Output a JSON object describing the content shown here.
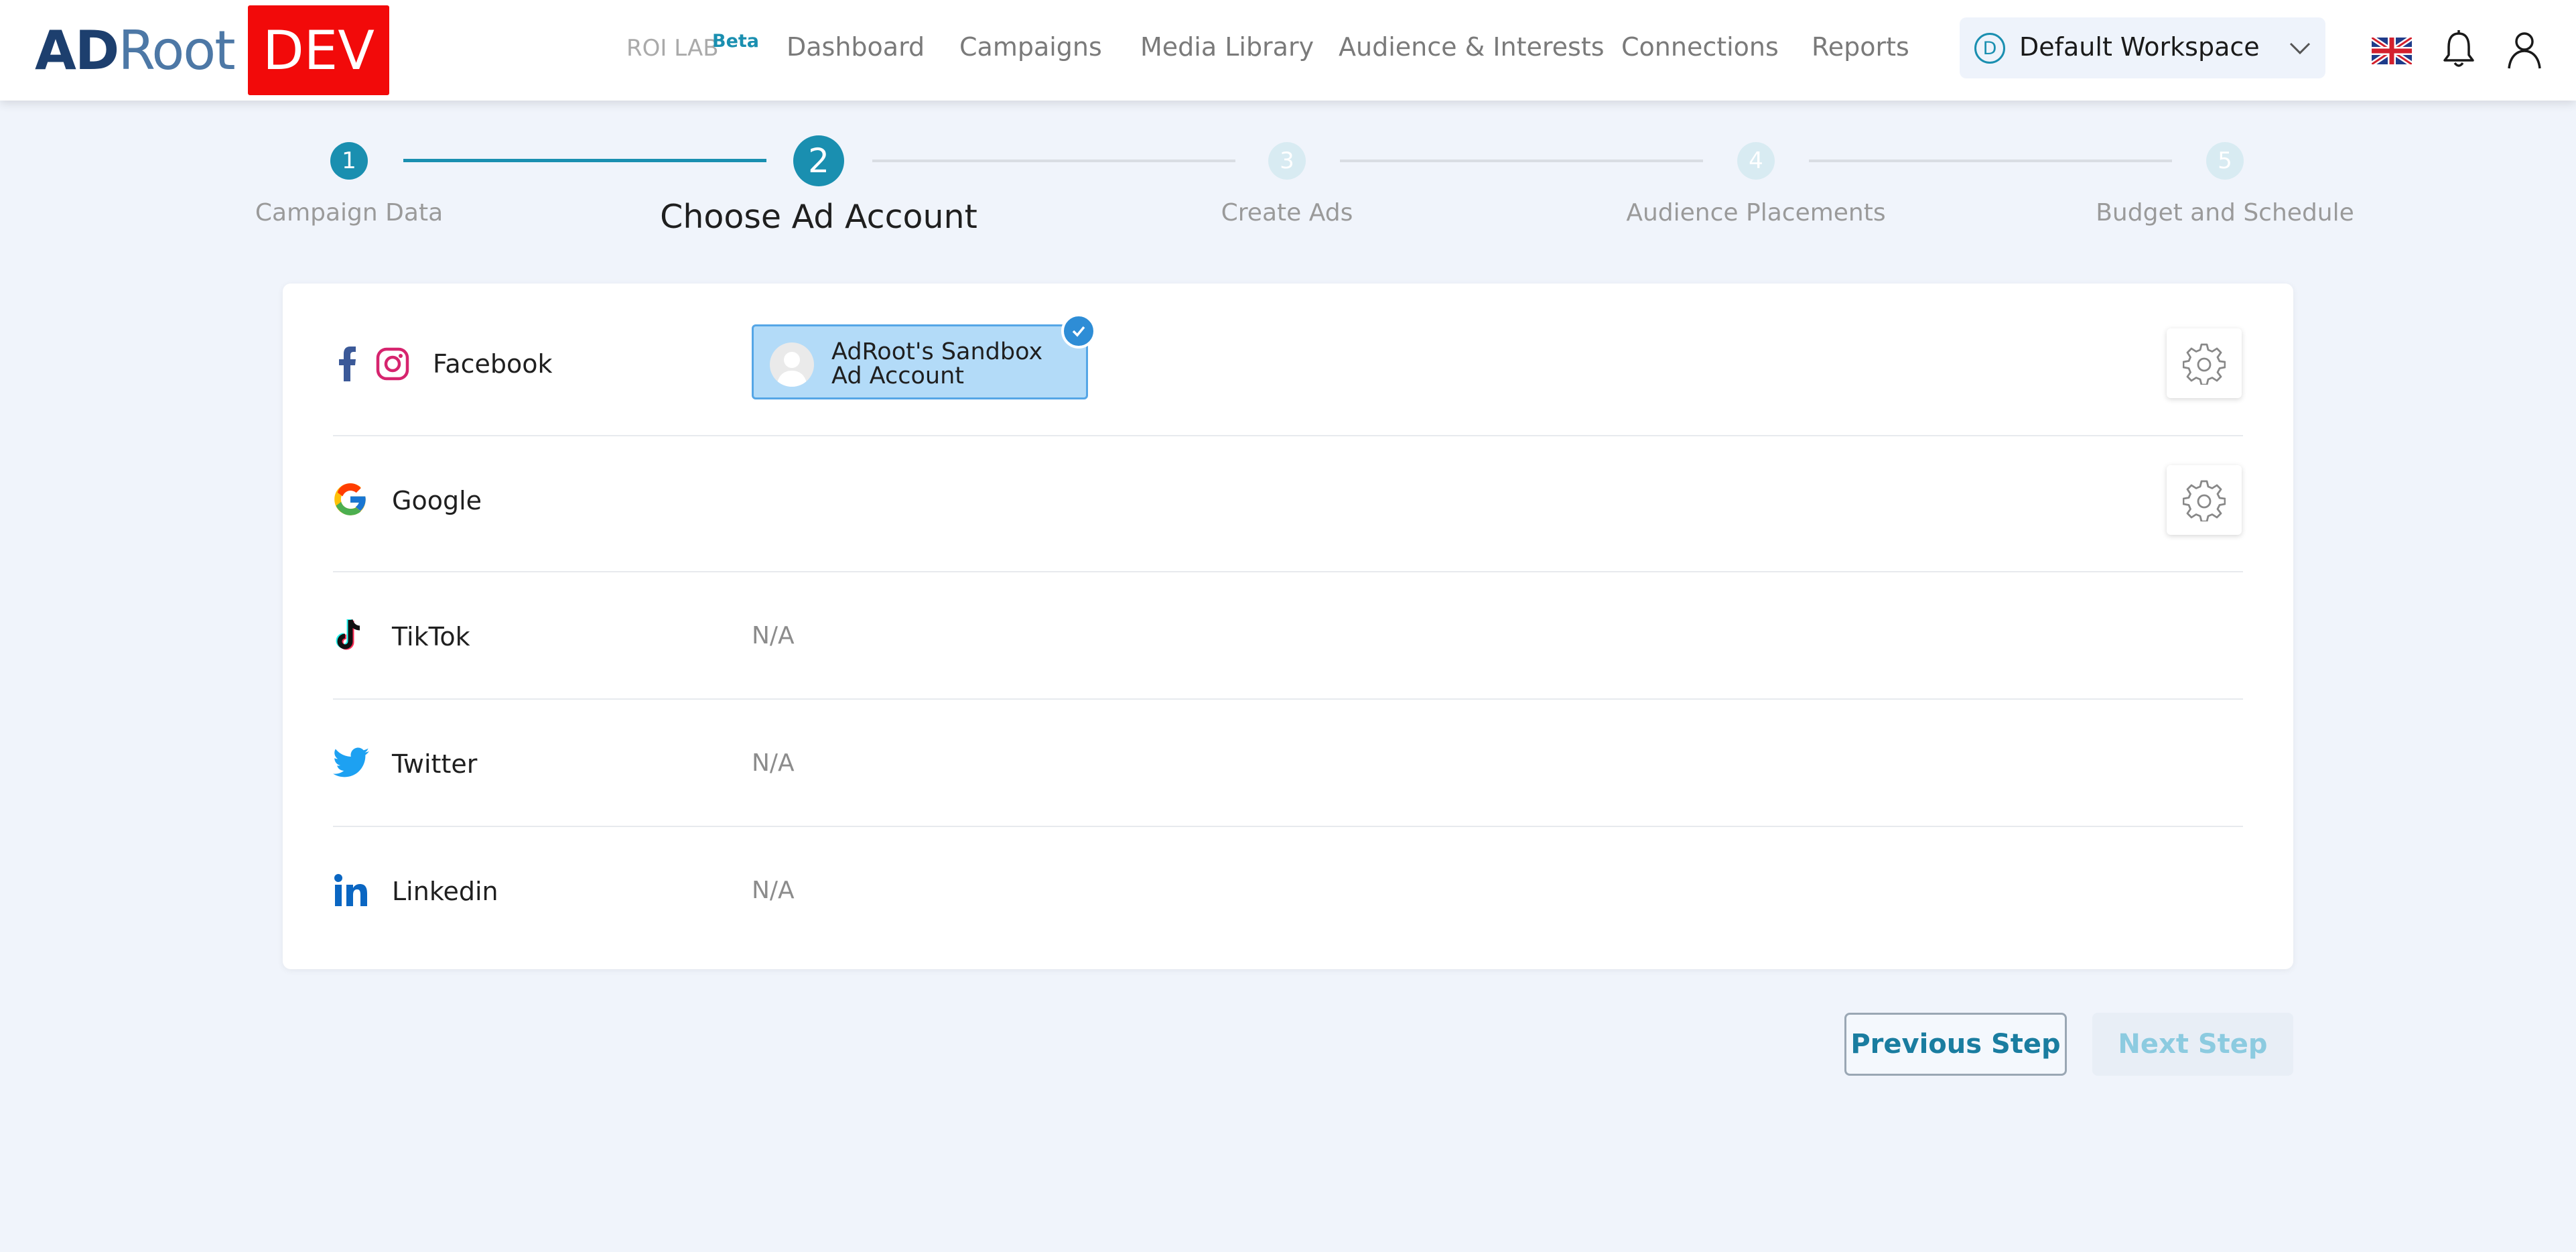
{
  "header": {
    "logo_ad": "AD",
    "logo_root": "Root",
    "env_badge": "DEV",
    "roi_lab": "ROI LAB",
    "roi_lab_badge": "Beta",
    "nav": [
      "Dashboard",
      "Campaigns",
      "Media Library",
      "Audience & Interests",
      "Connections",
      "Reports"
    ],
    "workspace": {
      "initial": "D",
      "name": "Default Workspace"
    },
    "icons": [
      "uk-flag-icon",
      "bell-icon",
      "user-icon"
    ]
  },
  "stepper": {
    "current_step": 2,
    "steps": [
      {
        "number": "1",
        "label": "Campaign Data",
        "state": "completed"
      },
      {
        "number": "2",
        "label": "Choose Ad Account",
        "state": "active"
      },
      {
        "number": "3",
        "label": "Create Ads",
        "state": "upcoming"
      },
      {
        "number": "4",
        "label": "Audience Placements",
        "state": "upcoming"
      },
      {
        "number": "5",
        "label": "Budget and Schedule",
        "state": "upcoming"
      }
    ]
  },
  "platforms": {
    "facebook": {
      "label": "Facebook",
      "account": "AdRoot's Sandbox Ad Account",
      "selected": true
    },
    "google": {
      "label": "Google"
    },
    "tiktok": {
      "label": "TikTok",
      "value": "N/A"
    },
    "twitter": {
      "label": "Twitter",
      "value": "N/A"
    },
    "linkedin": {
      "label": "Linkedin",
      "value": "N/A"
    }
  },
  "actions": {
    "previous": "Previous Step",
    "next": "Next Step"
  },
  "colors": {
    "accent": "#1a8fb0",
    "dev_badge": "#f20a0a",
    "chip_bg": "#b3dbf8",
    "page_bg": "#f0f4fb"
  }
}
